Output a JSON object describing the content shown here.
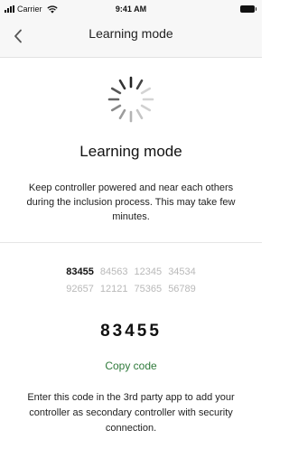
{
  "status_bar": {
    "carrier": "Carrier",
    "time": "9:41 AM",
    "icons": [
      "signal-bars-icon",
      "wifi-icon",
      "battery-icon"
    ]
  },
  "nav": {
    "back_icon": "chevron-left-icon",
    "title": "Learning mode"
  },
  "main": {
    "spinner_icon": "activity-spinner-icon",
    "heading": "Learning mode",
    "description": "Keep controller powered and near each others during the inclusion process. This may take few minutes."
  },
  "codes": {
    "row1": [
      "83455",
      "84563",
      "12345",
      "34534"
    ],
    "row2": [
      "92657",
      "12121",
      "75365",
      "56789"
    ],
    "active_index": 0
  },
  "selected_code": "83455",
  "copy_label": "Copy code",
  "instruction": "Enter this code in the 3rd party app to add your controller as secondary controller with security connection.",
  "colors": {
    "accent": "#2f7a3b",
    "inactive_code": "#b9b9b9",
    "bar_background": "#f7f7f7"
  }
}
